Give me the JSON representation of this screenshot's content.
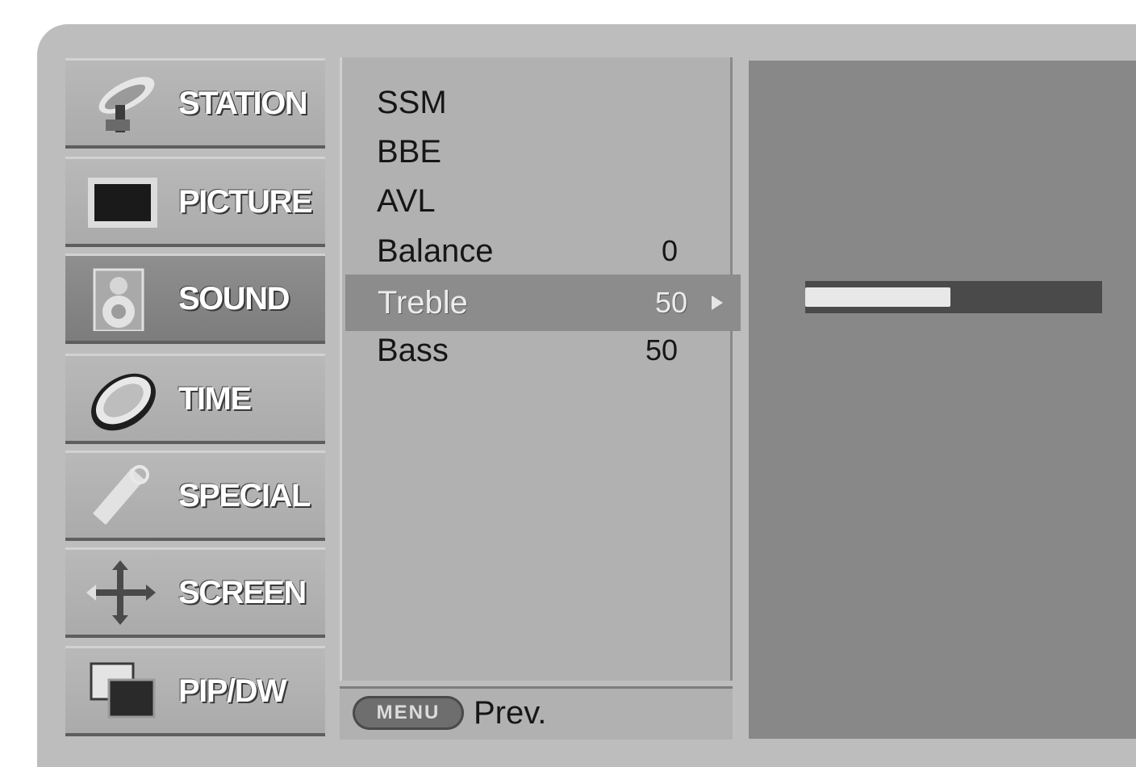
{
  "nav": {
    "items": [
      {
        "label": "STATION",
        "icon": "satellite-dish-icon",
        "active": false
      },
      {
        "label": "PICTURE",
        "icon": "tv-screen-icon",
        "active": false
      },
      {
        "label": "SOUND",
        "icon": "speaker-icon",
        "active": true
      },
      {
        "label": "TIME",
        "icon": "clock-icon",
        "active": false
      },
      {
        "label": "SPECIAL",
        "icon": "key-tag-icon",
        "active": false
      },
      {
        "label": "SCREEN",
        "icon": "move-arrows-icon",
        "active": false
      },
      {
        "label": "PIP/DW",
        "icon": "pip-windows-icon",
        "active": false
      }
    ]
  },
  "submenu": {
    "items": [
      {
        "label": "SSM",
        "value": ""
      },
      {
        "label": "BBE",
        "value": ""
      },
      {
        "label": "AVL",
        "value": ""
      },
      {
        "label": "Balance",
        "value": "0"
      },
      {
        "label": "Treble",
        "value": "50",
        "selected": true
      },
      {
        "label": "Bass",
        "value": "50"
      }
    ]
  },
  "footer": {
    "menu_key": "MENU",
    "prev_label": "Prev."
  },
  "slider": {
    "level": 0.49
  },
  "colors": {
    "panel": "#b1b1b1",
    "selected": "#8c8c8c",
    "right_panel": "#888888"
  }
}
